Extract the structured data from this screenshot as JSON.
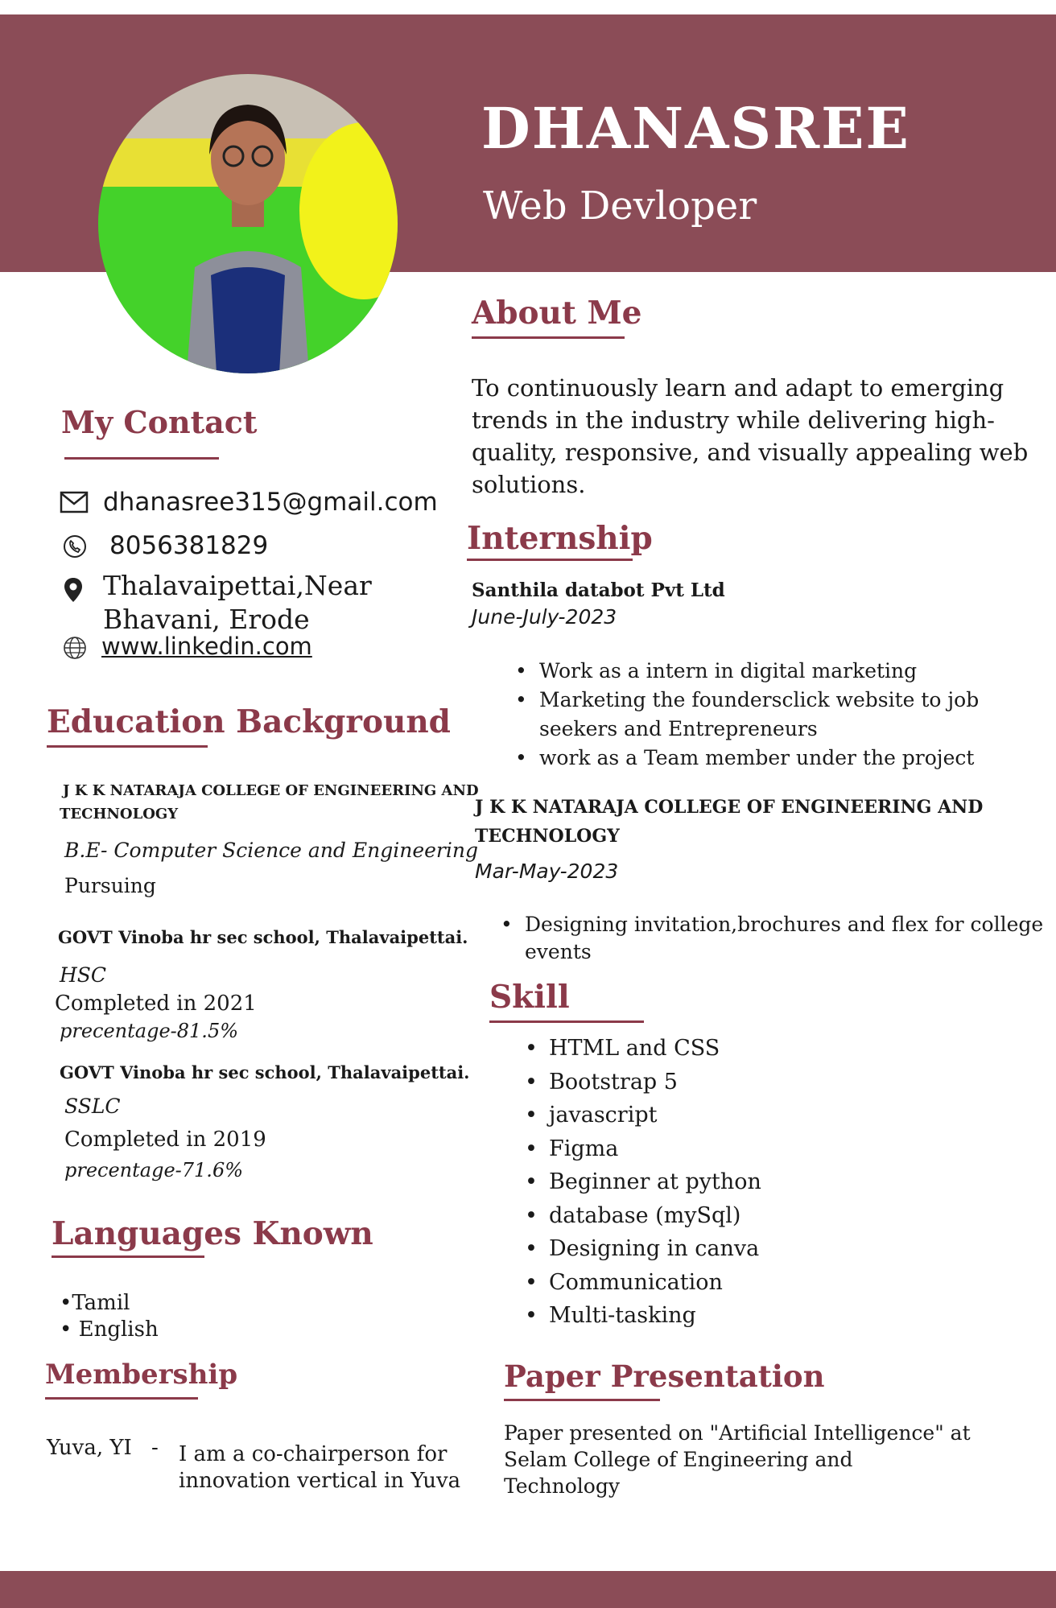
{
  "header": {
    "name": "DHANASREE",
    "role": "Web Devloper"
  },
  "contact": {
    "heading": "My Contact",
    "email": "dhanasree315@gmail.com",
    "phone": "8056381829",
    "address_line1": "Thalavaipettai,Near",
    "address_line2": "Bhavani, Erode",
    "website": "www.linkedin.com"
  },
  "education": {
    "heading": "Education Background",
    "college": {
      "name_line1": "J K K NATARAJA COLLEGE OF ENGINEERING AND",
      "name_line2": "TECHNOLOGY",
      "degree": "B.E- Computer Science and Engineering",
      "status": "Pursuing"
    },
    "hsc": {
      "school": "GOVT Vinoba hr sec school, Thalavaipettai.",
      "level": "HSC",
      "completed": "Completed in 2021",
      "percentage": "precentage-81.5%"
    },
    "sslc": {
      "school": "GOVT Vinoba hr sec school, Thalavaipettai.",
      "level": "SSLC",
      "completed": "Completed in 2019",
      "percentage": "precentage-71.6%"
    }
  },
  "languages": {
    "heading": "Languages Known",
    "items": [
      "•Tamil",
      "• English"
    ]
  },
  "membership": {
    "heading": "Membership",
    "org": "Yuva, YI",
    "dash": "-",
    "desc_line1": "I am a co-chairperson for",
    "desc_line2": "innovation vertical in Yuva"
  },
  "about": {
    "heading": "About Me",
    "lines": [
      "To continuously learn and adapt to emerging",
      "trends in the industry while delivering high-",
      "quality, responsive, and visually appealing web",
      "solutions."
    ]
  },
  "internship": {
    "heading": "Internship",
    "company1": {
      "name": "Santhila databot Pvt Ltd",
      "period": "June-July-2023",
      "points": [
        "Work as a intern in digital marketing",
        "Marketing the foundersclick  website to job",
        "seekers and Entrepreneurs",
        "work as a Team member under the project"
      ]
    },
    "company2": {
      "name_line1": "J K K NATARAJA COLLEGE OF ENGINEERING AND",
      "name_line2": "TECHNOLOGY",
      "period": "Mar-May-2023",
      "points": [
        "Designing invitation,brochures and flex for college",
        "events"
      ]
    }
  },
  "skills": {
    "heading": "Skill",
    "items": [
      "HTML and CSS",
      "Bootstrap 5",
      "javascript",
      "Figma",
      "Beginner at python",
      "database (mySql)",
      "Designing in canva",
      "Communication",
      "Multi-tasking"
    ]
  },
  "paper": {
    "heading": "Paper Presentation",
    "lines": [
      "Paper presented on \"Artificial Intelligence\" at",
      "Selam College of Engineering and",
      "Technology"
    ]
  },
  "colors": {
    "accent": "#8b4c57",
    "heading": "#8b3a4a"
  }
}
